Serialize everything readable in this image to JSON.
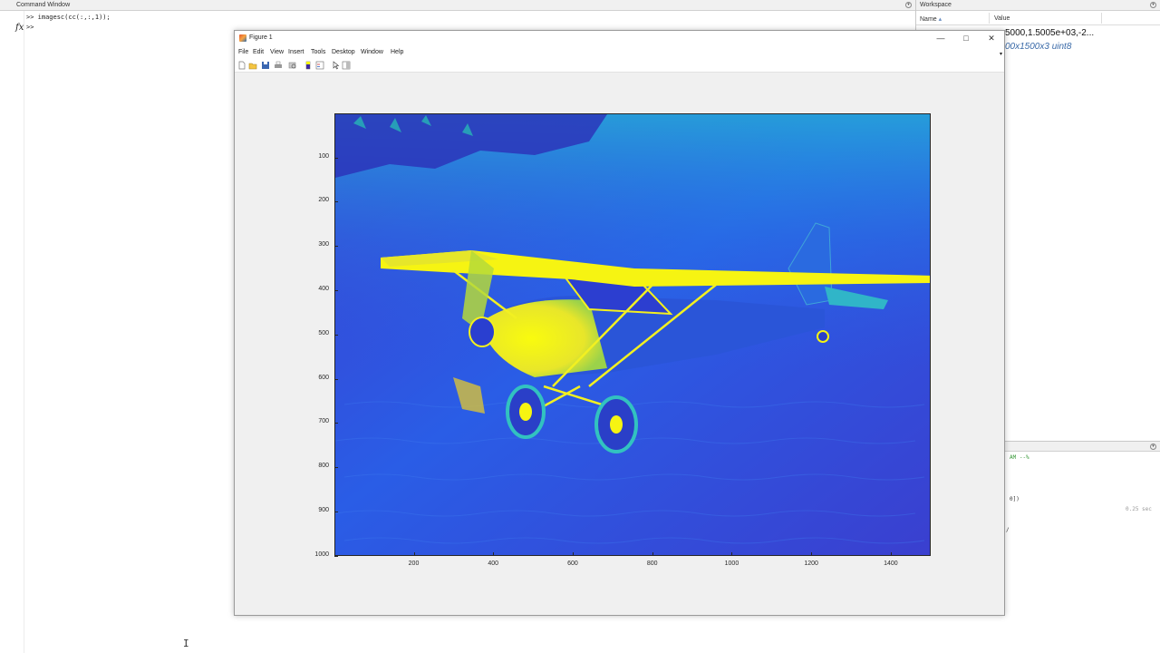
{
  "command_window": {
    "title": "Command Window",
    "lines": [
      ">> imagesc(cc(:,:,1));",
      ">>"
    ],
    "fx_symbol": "fx"
  },
  "workspace": {
    "title": "Workspace",
    "col_name": "Name",
    "col_name_sort": "▴",
    "col_value": "Value",
    "values": [
      "5000,1.5005e+03,-2...",
      "00x1500x3 uint8"
    ]
  },
  "history": {
    "lines": [
      "AM --%",
      "0])",
      "/"
    ],
    "timing": "0.25 sec"
  },
  "figure": {
    "title": "Figure 1",
    "window_controls": {
      "minimize": "—",
      "maximize": "□",
      "close": "✕"
    },
    "menu": [
      "File",
      "Edit",
      "View",
      "Insert",
      "Tools",
      "Desktop",
      "Window",
      "Help"
    ],
    "toolbar_icons": [
      "new-figure-icon",
      "open-file-icon",
      "save-icon",
      "print-icon",
      "print-preview-icon",
      "colorbar-icon",
      "legend-icon",
      "pointer-icon",
      "plot-tools-icon"
    ],
    "menu_arrow": "▾"
  },
  "chart_data": {
    "type": "heatmap",
    "title": "",
    "xlabel": "",
    "ylabel": "",
    "image_size": [
      1000,
      1500
    ],
    "colormap": "parula",
    "xlim": [
      0.5,
      1500.5
    ],
    "ylim": [
      0.5,
      1000.5
    ],
    "y_reversed": true,
    "x_ticks": [
      "200",
      "400",
      "600",
      "800",
      "1000",
      "1200",
      "1400"
    ],
    "y_ticks": [
      "100",
      "200",
      "300",
      "400",
      "500",
      "600",
      "700",
      "800",
      "900",
      "1000"
    ],
    "content": "airplane-over-water",
    "grid": false,
    "colors": {
      "low": "#3d26a8",
      "mid": "#1fa2d8",
      "high": "#f9fb0e"
    }
  }
}
